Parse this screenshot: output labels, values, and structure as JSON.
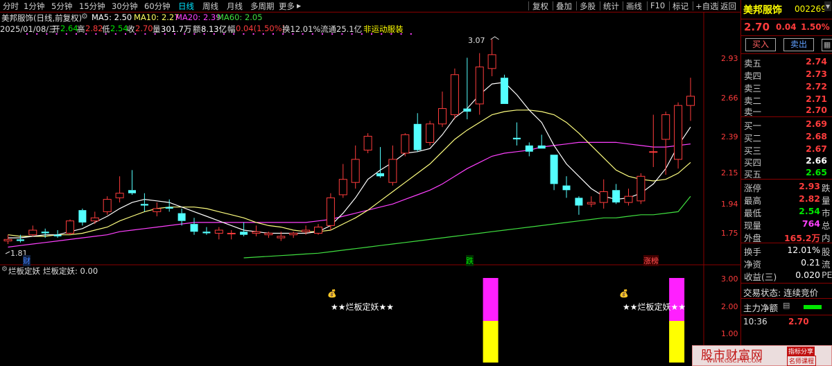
{
  "toolbar": {
    "items": [
      "分时",
      "1分钟",
      "5分钟",
      "15分钟",
      "30分钟",
      "60分钟",
      "日线",
      "周线",
      "月线",
      "多周期",
      "更多"
    ],
    "active_index": 6,
    "more_arrow": "▶",
    "right_items": [
      "复权",
      "叠加",
      "多股",
      "统计",
      "画线",
      "F10",
      "标记",
      "+自选",
      "返回"
    ]
  },
  "header": {
    "stock": "美邦服饰(日线,前复权)",
    "ma5": "MA5: 2.50",
    "ma10": "MA10: 2.27",
    "ma20": "MA20: 2.39",
    "ma60": "MA60: 2.05",
    "date": "2025/01/08/三",
    "open_lbl": "开",
    "open": "2.64",
    "high_lbl": "高",
    "high": "2.82",
    "low_lbl": "低",
    "low": "2.54",
    "close_lbl": "收",
    "close": "2.70",
    "vol_lbl": "量",
    "vol": "301.7万",
    "amt_lbl": "额",
    "amt": "8.13亿",
    "amp_lbl": "幅",
    "amp": "0.04(1.50%)",
    "turnover": "换12.01%",
    "float": "流通25.1亿",
    "sector": "非运动服装"
  },
  "price_axis": [
    "2.93",
    "2.66",
    "2.39",
    "2.15",
    "1.94",
    "1.75"
  ],
  "price_marks": {
    "high_label": "3.07",
    "low_label": "1.81",
    "tag_cai": "财",
    "tag_die": "跌",
    "tag_zhangting": "涨榜"
  },
  "indicator": {
    "title": "烂板定妖",
    "readout": "烂板定妖: 0.00",
    "label": "★★烂板定妖★★",
    "axis": [
      "3.00",
      "2.00",
      "1.00"
    ]
  },
  "chart_data": {
    "type": "candlestick",
    "y_range": [
      1.65,
      3.1
    ],
    "candles": [
      {
        "o": 1.76,
        "h": 1.8,
        "l": 1.74,
        "c": 1.77
      },
      {
        "o": 1.77,
        "h": 1.8,
        "l": 1.75,
        "c": 1.76
      },
      {
        "o": 1.8,
        "h": 1.86,
        "l": 1.79,
        "c": 1.83
      },
      {
        "o": 1.82,
        "h": 1.84,
        "l": 1.78,
        "c": 1.81
      },
      {
        "o": 1.8,
        "h": 1.83,
        "l": 1.78,
        "c": 1.79
      },
      {
        "o": 1.81,
        "h": 1.9,
        "l": 1.8,
        "c": 1.89
      },
      {
        "o": 1.96,
        "h": 1.97,
        "l": 1.86,
        "c": 1.88
      },
      {
        "o": 1.89,
        "h": 1.95,
        "l": 1.87,
        "c": 1.91
      },
      {
        "o": 1.95,
        "h": 2.05,
        "l": 1.93,
        "c": 2.03
      },
      {
        "o": 2.04,
        "h": 2.18,
        "l": 2.01,
        "c": 2.07
      },
      {
        "o": 2.09,
        "h": 2.22,
        "l": 2.06,
        "c": 2.07
      },
      {
        "o": 2.0,
        "h": 2.07,
        "l": 1.95,
        "c": 1.99
      },
      {
        "o": 1.95,
        "h": 2.01,
        "l": 1.92,
        "c": 1.97
      },
      {
        "o": 1.98,
        "h": 2.03,
        "l": 1.95,
        "c": 1.97
      },
      {
        "o": 1.94,
        "h": 1.97,
        "l": 1.86,
        "c": 1.89
      },
      {
        "o": 1.87,
        "h": 1.91,
        "l": 1.8,
        "c": 1.82
      },
      {
        "o": 1.82,
        "h": 1.85,
        "l": 1.8,
        "c": 1.81
      },
      {
        "o": 1.81,
        "h": 1.85,
        "l": 1.77,
        "c": 1.83
      },
      {
        "o": 1.81,
        "h": 1.83,
        "l": 1.77,
        "c": 1.81
      },
      {
        "o": 1.82,
        "h": 1.88,
        "l": 1.79,
        "c": 1.8
      },
      {
        "o": 1.81,
        "h": 1.86,
        "l": 1.79,
        "c": 1.82
      },
      {
        "o": 1.8,
        "h": 1.82,
        "l": 1.78,
        "c": 1.81
      },
      {
        "o": 1.78,
        "h": 1.82,
        "l": 1.76,
        "c": 1.79
      },
      {
        "o": 1.8,
        "h": 1.82,
        "l": 1.78,
        "c": 1.81
      },
      {
        "o": 1.82,
        "h": 1.86,
        "l": 1.8,
        "c": 1.83
      },
      {
        "o": 1.81,
        "h": 1.87,
        "l": 1.8,
        "c": 1.85
      },
      {
        "o": 1.86,
        "h": 2.07,
        "l": 1.83,
        "c": 2.04
      },
      {
        "o": 2.06,
        "h": 2.26,
        "l": 2.04,
        "c": 2.16
      },
      {
        "o": 2.14,
        "h": 2.38,
        "l": 2.1,
        "c": 2.29
      },
      {
        "o": 2.35,
        "h": 2.46,
        "l": 2.33,
        "c": 2.44
      },
      {
        "o": 2.2,
        "h": 2.37,
        "l": 2.17,
        "c": 2.18
      },
      {
        "o": 2.14,
        "h": 2.38,
        "l": 2.12,
        "c": 2.29
      },
      {
        "o": 2.33,
        "h": 2.46,
        "l": 2.31,
        "c": 2.45
      },
      {
        "o": 2.52,
        "h": 2.59,
        "l": 2.34,
        "c": 2.35
      },
      {
        "o": 2.4,
        "h": 2.54,
        "l": 2.38,
        "c": 2.52
      },
      {
        "o": 2.52,
        "h": 2.73,
        "l": 2.5,
        "c": 2.62
      },
      {
        "o": 2.58,
        "h": 2.88,
        "l": 2.55,
        "c": 2.84
      },
      {
        "o": 2.62,
        "h": 2.95,
        "l": 2.55,
        "c": 2.6
      },
      {
        "o": 2.65,
        "h": 2.98,
        "l": 2.58,
        "c": 2.89
      },
      {
        "o": 2.88,
        "h": 3.07,
        "l": 2.83,
        "c": 2.97
      },
      {
        "o": 2.82,
        "h": 2.84,
        "l": 2.65,
        "c": 2.65
      },
      {
        "o": 2.43,
        "h": 2.53,
        "l": 2.38,
        "c": 2.42
      },
      {
        "o": 2.38,
        "h": 2.4,
        "l": 2.31,
        "c": 2.34
      },
      {
        "o": 2.38,
        "h": 2.45,
        "l": 2.36,
        "c": 2.36
      },
      {
        "o": 2.32,
        "h": 2.32,
        "l": 2.09,
        "c": 2.13
      },
      {
        "o": 2.12,
        "h": 2.18,
        "l": 2.04,
        "c": 2.09
      },
      {
        "o": 2.04,
        "h": 2.05,
        "l": 1.93,
        "c": 1.99
      },
      {
        "o": 2.0,
        "h": 2.05,
        "l": 1.98,
        "c": 2.01
      },
      {
        "o": 2.01,
        "h": 2.16,
        "l": 1.97,
        "c": 2.08
      },
      {
        "o": 2.09,
        "h": 2.13,
        "l": 2.0,
        "c": 2.01
      },
      {
        "o": 2.01,
        "h": 2.1,
        "l": 1.99,
        "c": 2.05
      },
      {
        "o": 2.02,
        "h": 2.2,
        "l": 2.0,
        "c": 2.18
      },
      {
        "o": 2.34,
        "h": 2.58,
        "l": 2.24,
        "c": 2.34
      },
      {
        "o": 2.42,
        "h": 2.6,
        "l": 2.19,
        "c": 2.58
      },
      {
        "o": 2.29,
        "h": 2.66,
        "l": 2.23,
        "c": 2.64
      },
      {
        "o": 2.64,
        "h": 2.82,
        "l": 2.54,
        "c": 2.7
      }
    ],
    "ma5": [
      1.78,
      1.78,
      1.79,
      1.8,
      1.8,
      1.82,
      1.84,
      1.88,
      1.92,
      1.97,
      2.01,
      2.03,
      2.02,
      2.01,
      1.98,
      1.95,
      1.92,
      1.89,
      1.86,
      1.83,
      1.82,
      1.81,
      1.81,
      1.81,
      1.81,
      1.82,
      1.86,
      1.94,
      2.04,
      2.16,
      2.22,
      2.27,
      2.33,
      2.34,
      2.36,
      2.45,
      2.56,
      2.62,
      2.71,
      2.78,
      2.79,
      2.71,
      2.61,
      2.53,
      2.38,
      2.26,
      2.18,
      2.1,
      2.05,
      2.03,
      2.04,
      2.07,
      2.13,
      2.23,
      2.38,
      2.5
    ],
    "ma10": [
      1.8,
      1.79,
      1.79,
      1.79,
      1.8,
      1.8,
      1.81,
      1.83,
      1.85,
      1.89,
      1.92,
      1.95,
      1.97,
      1.98,
      1.98,
      1.98,
      1.97,
      1.95,
      1.93,
      1.91,
      1.88,
      1.86,
      1.85,
      1.83,
      1.82,
      1.82,
      1.83,
      1.87,
      1.91,
      1.96,
      2.02,
      2.08,
      2.14,
      2.2,
      2.26,
      2.34,
      2.42,
      2.48,
      2.53,
      2.58,
      2.6,
      2.61,
      2.61,
      2.6,
      2.58,
      2.53,
      2.46,
      2.38,
      2.3,
      2.22,
      2.18,
      2.16,
      2.15,
      2.16,
      2.2,
      2.27
    ],
    "ma20": [
      1.72,
      1.73,
      1.74,
      1.75,
      1.76,
      1.77,
      1.78,
      1.79,
      1.8,
      1.82,
      1.83,
      1.84,
      1.85,
      1.86,
      1.87,
      1.88,
      1.88,
      1.88,
      1.88,
      1.88,
      1.88,
      1.88,
      1.88,
      1.88,
      1.88,
      1.89,
      1.9,
      1.92,
      1.94,
      1.96,
      1.98,
      2.0,
      2.03,
      2.06,
      2.09,
      2.13,
      2.18,
      2.23,
      2.27,
      2.31,
      2.33,
      2.34,
      2.35,
      2.37,
      2.38,
      2.39,
      2.4,
      2.4,
      2.4,
      2.4,
      2.39,
      2.38,
      2.37,
      2.37,
      2.38,
      2.39
    ],
    "ma60_from": 19,
    "ma60": [
      1.65,
      1.655,
      1.66,
      1.665,
      1.67,
      1.675,
      1.68,
      1.69,
      1.7,
      1.71,
      1.72,
      1.73,
      1.74,
      1.75,
      1.76,
      1.77,
      1.78,
      1.79,
      1.8,
      1.81,
      1.82,
      1.83,
      1.84,
      1.85,
      1.86,
      1.87,
      1.88,
      1.89,
      1.9,
      1.91,
      1.91,
      1.92,
      1.93,
      1.93,
      1.94,
      1.95,
      2.05
    ],
    "indicator_signals": [
      39,
      54
    ]
  },
  "right_panel": {
    "name": "美邦服饰",
    "code": "002269",
    "price": "2.70",
    "change": "0.04",
    "pct": "1.50%",
    "buy_btn": "买入",
    "sell_btn": "卖出",
    "asks": [
      {
        "label": "卖五",
        "price": "2.74"
      },
      {
        "label": "卖四",
        "price": "2.73"
      },
      {
        "label": "卖三",
        "price": "2.72"
      },
      {
        "label": "卖二",
        "price": "2.71"
      },
      {
        "label": "卖一",
        "price": "2.70"
      }
    ],
    "bids": [
      {
        "label": "买一",
        "price": "2.69"
      },
      {
        "label": "买二",
        "price": "2.68"
      },
      {
        "label": "买三",
        "price": "2.67"
      },
      {
        "label": "买四",
        "price": "2.66"
      },
      {
        "label": "买五",
        "price": "2.65"
      }
    ],
    "stats": [
      {
        "label": "涨停",
        "value": "2.93",
        "suffix": "跌"
      },
      {
        "label": "最高",
        "value": "2.82",
        "suffix": "量"
      },
      {
        "label": "最低",
        "value": "2.54",
        "suffix": "市"
      },
      {
        "label": "现量",
        "value": "764",
        "suffix": "总"
      },
      {
        "label": "外盘",
        "value": "165.2万",
        "suffix": "内"
      }
    ],
    "stats2": [
      {
        "label": "换手",
        "value": "12.01%",
        "suffix": "股"
      },
      {
        "label": "净资",
        "value": "0.21",
        "suffix": "流"
      },
      {
        "label": "收益(三)",
        "value": "0.020",
        "suffix": "PE"
      }
    ],
    "trade_status": "交易状态: 连续竞价",
    "main_net": "主力净额",
    "time": "10:36",
    "time_price": "2.70"
  },
  "watermark": {
    "title": "股市财富网",
    "tag1": "指标分享",
    "tag2": "名师课程",
    "url": "WWW.GSCFW.COM"
  }
}
